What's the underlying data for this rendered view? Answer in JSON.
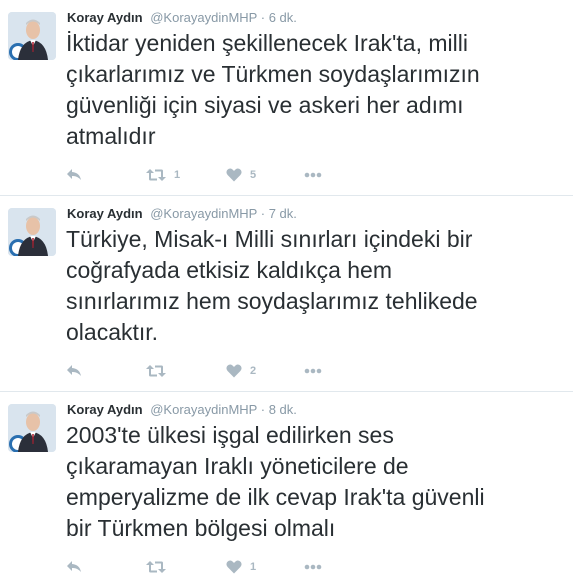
{
  "colors": {
    "text": "#292f33",
    "meta": "#8899a6",
    "action_icon": "#aab8c2",
    "divider": "#e1e8ed"
  },
  "tweets": [
    {
      "author_name": "Koray Aydın",
      "handle": "@KorayaydinMHP",
      "separator": "·",
      "time": "6 dk.",
      "text": "İktidar yeniden şekillenecek Irak'ta, milli\nçıkarlarımız ve Türkmen soydaşlarımızın\ngüvenliği için siyasi ve askeri her adımı\natmalıdır",
      "actions": {
        "reply_icon": "reply-icon",
        "retweet_icon": "retweet-icon",
        "retweet_count": "1",
        "like_icon": "heart-icon",
        "like_count": "5",
        "more_icon": "more-dots-icon"
      }
    },
    {
      "author_name": "Koray Aydın",
      "handle": "@KorayaydinMHP",
      "separator": "·",
      "time": "7 dk.",
      "text": "Türkiye, Misak-ı Milli sınırları içindeki bir\ncoğrafyada etkisiz kaldıkça hem\nsınırlarımız hem soydaşlarımız tehlikede\nolacaktır.",
      "actions": {
        "reply_icon": "reply-icon",
        "retweet_icon": "retweet-icon",
        "retweet_count": "",
        "like_icon": "heart-icon",
        "like_count": "2",
        "more_icon": "more-dots-icon"
      }
    },
    {
      "author_name": "Koray Aydın",
      "handle": "@KorayaydinMHP",
      "separator": "·",
      "time": "8 dk.",
      "text": "2003'te ülkesi işgal edilirken ses\nçıkaramayan Iraklı yöneticilere de\nemperyalizme de ilk cevap Irak'ta güvenli\nbir Türkmen bölgesi olmalı",
      "actions": {
        "reply_icon": "reply-icon",
        "retweet_icon": "retweet-icon",
        "retweet_count": "",
        "like_icon": "heart-icon",
        "like_count": "1",
        "more_icon": "more-dots-icon"
      }
    }
  ]
}
